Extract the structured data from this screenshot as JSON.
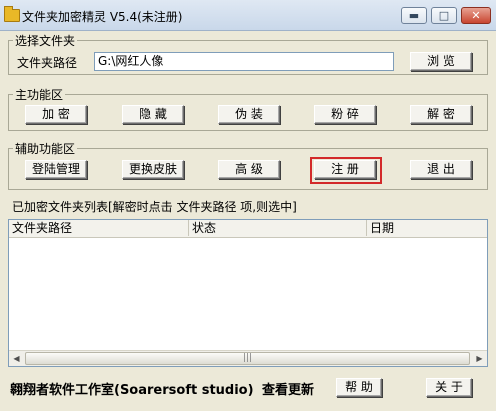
{
  "window": {
    "title": "文件夹加密精灵 V5.4(未注册)",
    "minimize_icon": "minimize-icon",
    "maximize_icon": "maximize-icon",
    "close_icon": "close-icon"
  },
  "select_folder": {
    "legend": "选择文件夹",
    "path_label": "文件夹路径",
    "path_value": "G:\\网红人像",
    "browse_label": "浏 览"
  },
  "main_functions": {
    "legend": "主功能区",
    "buttons": [
      "加 密",
      "隐 藏",
      "伪 装",
      "粉 碎",
      "解 密"
    ]
  },
  "aux_functions": {
    "legend": "辅助功能区",
    "buttons": [
      "登陆管理",
      "更换皮肤",
      "高 级",
      "注 册",
      "退 出"
    ],
    "highlight_color": "#d32a2a"
  },
  "encrypted_list": {
    "legend": "已加密文件夹列表[解密时点击 文件夹路径 项,则选中]",
    "columns": [
      "文件夹路径",
      "状态",
      "日期"
    ],
    "rows": [],
    "scroll_left": "◀",
    "scroll_right": "▶",
    "scroll_grip": "|||"
  },
  "footer": {
    "studio": "翱翔者软件工作室(Soarersoft studio)",
    "update": "查看更新",
    "help_label": "帮 助",
    "about_label": "关 于"
  }
}
